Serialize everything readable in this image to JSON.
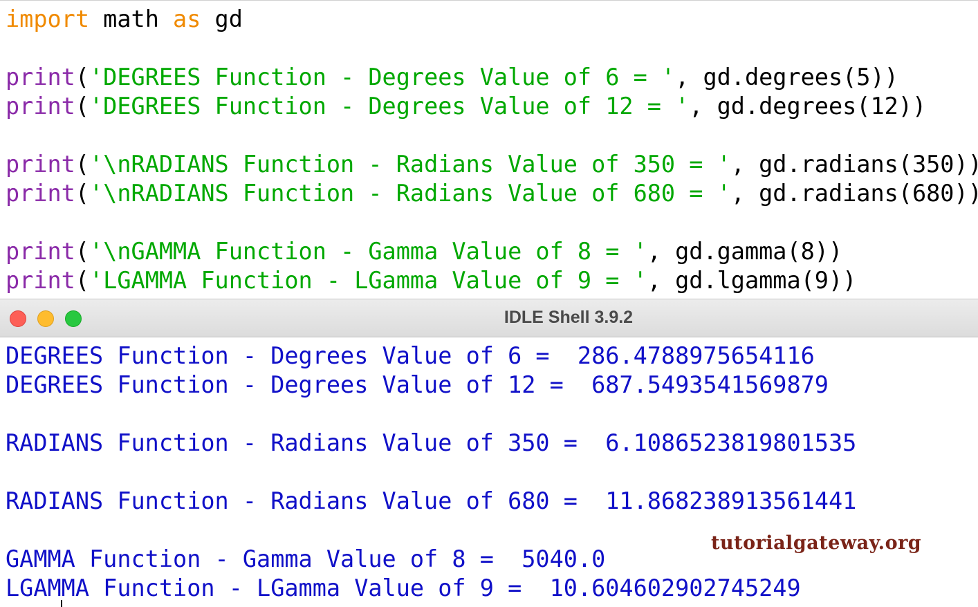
{
  "editor": {
    "lines": [
      {
        "kw1": "import",
        "mid": " math ",
        "kw2": "as",
        "end": " gd"
      },
      {
        "fn": "print",
        "open": "(",
        "str": "'DEGREES Function - Degrees Value of 6 = '",
        "rest": ", gd.degrees(5))"
      },
      {
        "fn": "print",
        "open": "(",
        "str": "'DEGREES Function - Degrees Value of 12 = '",
        "rest": ", gd.degrees(12))"
      },
      {
        "fn": "print",
        "open": "(",
        "str": "'\\nRADIANS Function - Radians Value of 350 = '",
        "rest": ", gd.radians(350))"
      },
      {
        "fn": "print",
        "open": "(",
        "str": "'\\nRADIANS Function - Radians Value of 680 = '",
        "rest": ", gd.radians(680))"
      },
      {
        "fn": "print",
        "open": "(",
        "str": "'\\nGAMMA Function - Gamma Value of 8 = '",
        "rest": ", gd.gamma(8))"
      },
      {
        "fn": "print",
        "open": "(",
        "str": "'LGAMMA Function - LGamma Value of 9 = '",
        "rest": ", gd.lgamma(9))"
      }
    ]
  },
  "window": {
    "title": "IDLE Shell 3.9.2"
  },
  "shell": {
    "lines": [
      "DEGREES Function - Degrees Value of 6 =  286.4788975654116",
      "DEGREES Function - Degrees Value of 12 =  687.5493541569879",
      "RADIANS Function - Radians Value of 350 =  6.1086523819801535",
      "RADIANS Function - Radians Value of 680 =  11.868238913561441",
      "GAMMA Function - Gamma Value of 8 =  5040.0",
      "LGAMMA Function - LGamma Value of 9 =  10.604602902745249"
    ]
  },
  "watermark": "tutorialgateway.org",
  "colors": {
    "keyword": "#f08a00",
    "builtin": "#8a2aa8",
    "string": "#00a800",
    "output": "#1010c8"
  }
}
